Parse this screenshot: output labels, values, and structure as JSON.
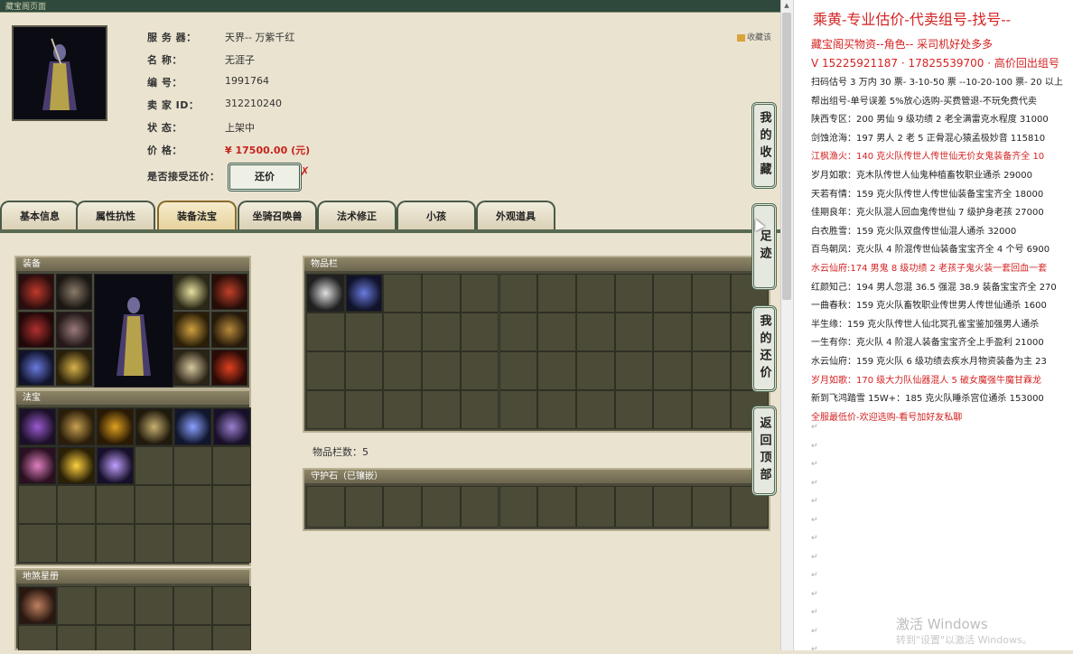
{
  "window": {
    "title": "藏宝阁页面"
  },
  "character": {
    "server_label": "服 务 器：",
    "server": "天界-- 万紫千红",
    "name_label": "名          称：",
    "name": "无涯子",
    "id_label": "编          号：",
    "id": "1991764",
    "seller_label": "卖  家    ID：",
    "seller_id": "312210240",
    "status_label": "状          态：",
    "status": "上架中",
    "price_label": "价          格：",
    "price": "¥ 17500.00 (元)",
    "counter_label": "是否接受还价：",
    "counter_button": "还价",
    "counter_x": "✗"
  },
  "favorite": {
    "label": "收藏该",
    "icon": "star-folder-icon"
  },
  "tabs": [
    {
      "label": "基本信息"
    },
    {
      "label": "属性抗性"
    },
    {
      "label": "装备法宝"
    },
    {
      "label": "坐骑召唤兽"
    },
    {
      "label": "法术修正"
    },
    {
      "label": "小孩"
    },
    {
      "label": "外观道具"
    }
  ],
  "active_tab": "装备法宝",
  "panels": {
    "equipment": "装备",
    "treasure": "法宝",
    "realm": "地煞星册",
    "inventory": "物品栏",
    "inventory_count": "物品栏数：5",
    "guard_stone": "守护石（已镶嵌）"
  },
  "side_buttons": [
    {
      "label": "我的收藏"
    },
    {
      "label": "足迹"
    },
    {
      "label": "我的还价"
    },
    {
      "label": "返回顶部"
    }
  ],
  "doc": {
    "title": "乘黄-专业估价-代卖组号-找号--",
    "lines": [
      {
        "text": "藏宝阁买物资--角色-- 采司机好处多多",
        "red": true,
        "big": true
      },
      {
        "text": "V 15225921187 · 17825539700 · 高价回出组号",
        "red": true,
        "big": true
      },
      {
        "text": "扫码估号 3 万内 30 票- 3-10-50 票  --10-20-100 票- 20 以上",
        "red": false
      },
      {
        "text": "帮出组号-单号误差 5%放心选购-买费管退-不玩免费代卖",
        "red": false
      },
      {
        "text": "陕西专区：200 男仙 9 级功绩 2 老全满雷克水程度 31000",
        "red": false
      },
      {
        "text": "剑蚀沧海：197 男人 2 老 5 正骨混心猿孟极妙音 115810",
        "red": false
      },
      {
        "text": "江枫渔火：140 克火队传世人传世仙无价女鬼装备齐全 10",
        "red": true
      },
      {
        "text": "岁月如歌：克木队传世人仙鬼种植畜牧职业通杀 29000",
        "red": false
      },
      {
        "text": "天若有情：159 克火队传世人传世仙装备宝宝齐全 18000",
        "red": false
      },
      {
        "text": "佳期良年：克火队混人回血鬼传世仙 7 级护身老孩 27000",
        "red": false
      },
      {
        "text": "白衣胜雪：159 克火队双盘传世仙混人通杀 32000",
        "red": false
      },
      {
        "text": "百鸟朝凤：克火队 4 阶混传世仙装备宝宝齐全 4 个号 6900",
        "red": false
      },
      {
        "text": "水云仙府:174 男鬼 8 级功绩 2 老孩子鬼火装一套回血一套",
        "red": true
      },
      {
        "text": "红颜知己：194 男人忽混 36.5 强混 38.9 装备宝宝齐全 270",
        "red": false
      },
      {
        "text": "一曲春秋：159 克火队畜牧职业传世男人传世仙通杀 1600",
        "red": false
      },
      {
        "text": "半生缘：159 克火队传世人仙北冥孔雀宝鉴加强男人通杀",
        "red": false
      },
      {
        "text": "一生有你：克火队 4 阶混人装备宝宝齐全上手盈利 21000",
        "red": false
      },
      {
        "text": "水云仙府：159 克火队 6 级功绩去疾水月物资装备为主 23",
        "red": false
      },
      {
        "text": "岁月如歌：170 级大力队仙器混人 5 破女魔强牛魔甘霖龙",
        "red": true
      },
      {
        "text": "新到飞鸿踏雪 15W+：185 克火队睡杀宫位通杀 153000",
        "red": false
      },
      {
        "text": "全服最低价-欢迎选购-看号加好友私聊",
        "red": true
      }
    ],
    "paragraph_mark": "↵"
  },
  "watermark": {
    "line1": "激活 Windows",
    "line2": "转到\"设置\"以激活 Windows。"
  },
  "colors": {
    "price_red": "#c8231c",
    "doc_red": "#d42222",
    "panel_bg": "#4b4b38",
    "frame_green": "#4f6a52"
  }
}
